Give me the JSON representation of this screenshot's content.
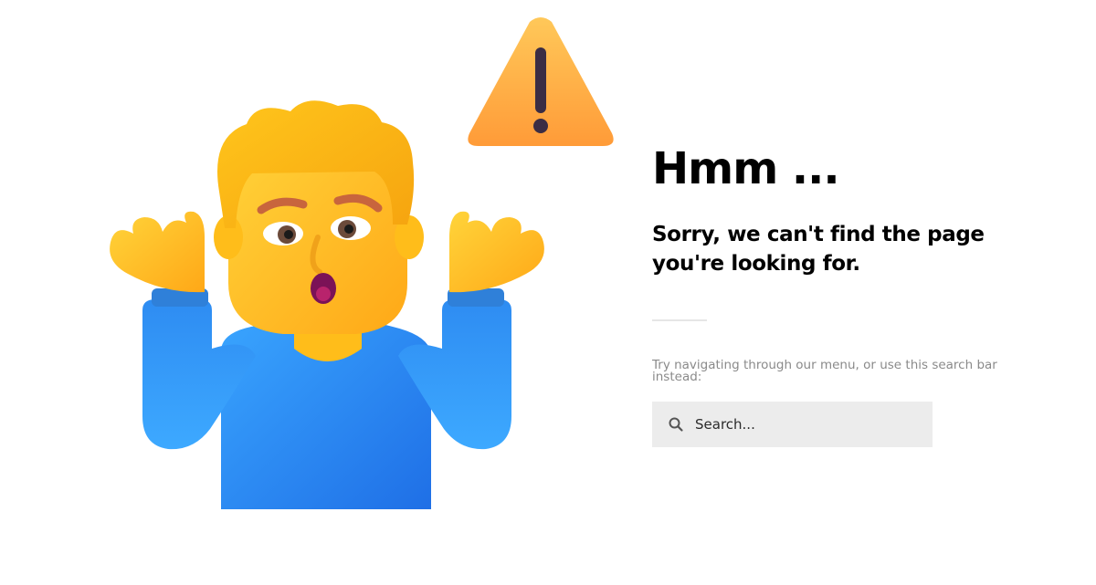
{
  "illustration": {
    "person_icon": "shrugging-person-icon",
    "warning_icon": "warning-triangle-icon"
  },
  "error_page": {
    "heading": "Hmm ...",
    "subheading": "Sorry, we can't find the page you're looking for.",
    "hint": "Try navigating through our menu, or use this search bar instead:"
  },
  "search": {
    "placeholder": "Search...",
    "value": "",
    "icon": "search-icon"
  },
  "colors": {
    "text": "#000000",
    "hint_text": "#8a8a8a",
    "search_background": "#ececec",
    "divider": "#e6e6e6",
    "shirt_blue": "#2f90f5",
    "skin_yellow": "#ffc21f",
    "warning_orange": "#ffb33f"
  }
}
